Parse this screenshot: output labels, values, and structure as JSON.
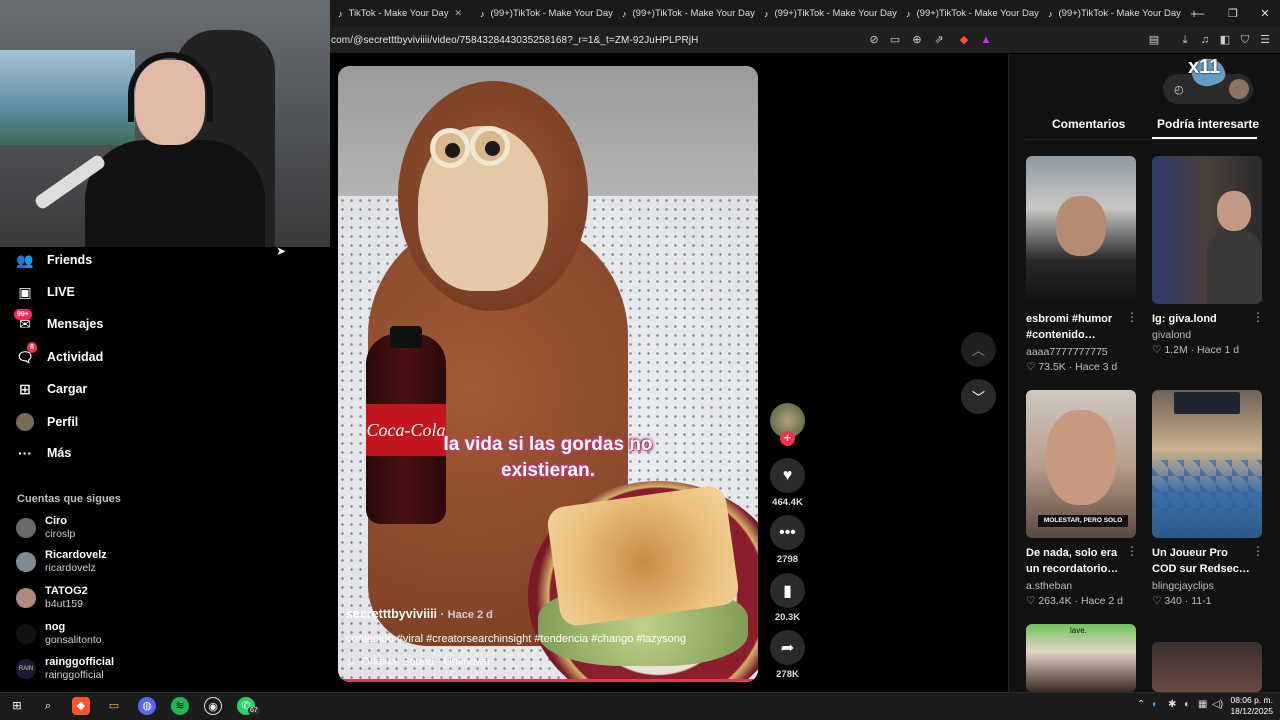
{
  "browser": {
    "tabs": [
      {
        "title": "TikTok - Make Your Day"
      },
      {
        "title": "(99+)TikTok - Make Your Day"
      },
      {
        "title": "(99+)TikTok - Make Your Day"
      },
      {
        "title": "(99+)TikTok - Make Your Day"
      },
      {
        "title": "(99+)TikTok - Make Your Day"
      },
      {
        "title": "(99+)TikTok - Make Your Day"
      }
    ],
    "url": "com/@secretttbyviviiii/video/7584328443035258168?_r=1&_t=ZM-92JuHPLPRjH",
    "new_tab": "+",
    "window_controls": {
      "minimize": "—",
      "restore": "❐",
      "close": "✕"
    }
  },
  "sidebar": {
    "items": [
      {
        "label": "Friends",
        "icon": "friends-icon"
      },
      {
        "label": "LIVE",
        "icon": "live-icon"
      },
      {
        "label": "Mensajes",
        "icon": "messages-icon",
        "badge": "99+"
      },
      {
        "label": "Actividad",
        "icon": "activity-icon",
        "badge": "8"
      },
      {
        "label": "Cargar",
        "icon": "upload-icon"
      },
      {
        "label": "Perfil",
        "icon": "profile-icon"
      },
      {
        "label": "Más",
        "icon": "more-icon"
      }
    ],
    "following_title": "Cuentas que sigues",
    "following": [
      {
        "name": "Ciro",
        "handle": "ciroslp"
      },
      {
        "name": "Ricardovelz",
        "handle": "ricardovelz"
      },
      {
        "name": "TATOG2",
        "handle": "b4ut159"
      },
      {
        "name": "nog",
        "handle": "gonsalitonto"
      },
      {
        "name": "rainggofficial",
        "handle": "rainggofficial",
        "avatar_text": "RAIN"
      }
    ]
  },
  "video": {
    "overlay_text_line1": "la vida si las gordas no",
    "overlay_text_line2": "existieran.",
    "bottle_label": "Coca-Cola",
    "author": "secretttbyviviiii",
    "separator": "·",
    "posted": "Hace 2 d",
    "caption": "contenido #viral #creatorsearchinsight #tendencia #chango #lazysong",
    "sound": "Original Sound - Unknown",
    "sound_icon": "♫"
  },
  "actions": {
    "likes": "464.4K",
    "comments": "2798",
    "saves": "20.3K",
    "shares": "278K",
    "follow_plus": "+"
  },
  "right_panel": {
    "tabs": [
      "Comentarios",
      "Podría interesarte"
    ],
    "active_tab": "Podría interesarte",
    "overlay_count": "x11",
    "recommendations": [
      {
        "title": "esbromi #humor #contenido…",
        "user": "aaaa7777777775",
        "likes": "73.5K",
        "sep": "·",
        "when": "Hace 3 d",
        "thumb_text": ""
      },
      {
        "title": "Ig: giva.lond",
        "user": "givalond",
        "likes": "1.2M",
        "sep": "·",
        "when": "Hace 1 d",
        "thumb_text": ""
      },
      {
        "title": "De nada, solo era un recordatorio…",
        "user": "a.stheban",
        "likes": "263.4K",
        "sep": "·",
        "when": "Hace 2 d",
        "thumb_text": "MOLESTAR, PERO SOLO"
      },
      {
        "title": "Un Joueur Pro COD sur Redsec…",
        "user": "blingcjayclips",
        "likes": "340",
        "sep": "·",
        "when": "11-1",
        "thumb_text": ""
      }
    ],
    "partial_thumb_text": "lave."
  },
  "taskbar": {
    "time": "08:06 p. m.",
    "date": "18/12/2025",
    "whatsapp_badge": "67",
    "chevron": "⌃"
  },
  "colors": {
    "accent": "#fe2c55",
    "background": "#000000",
    "panel": "#121212"
  }
}
